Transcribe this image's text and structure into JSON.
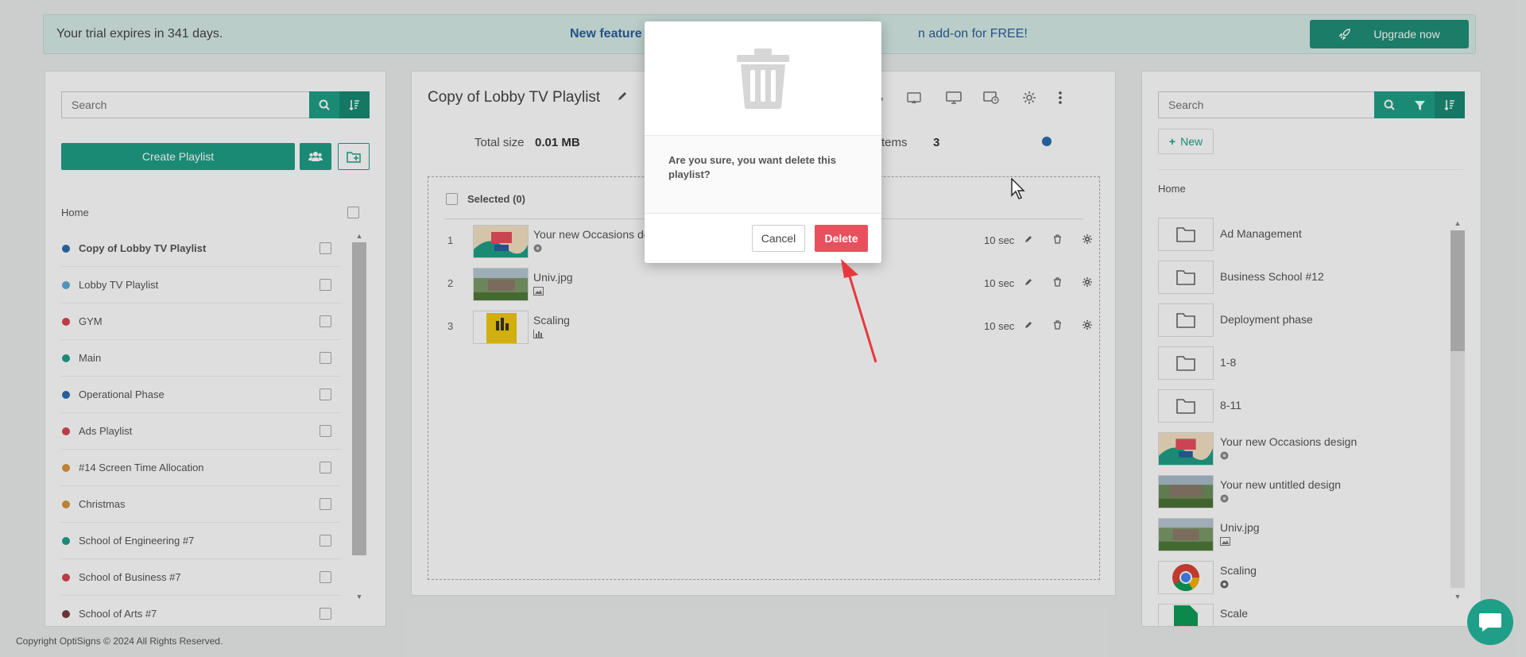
{
  "banner": {
    "trial_text": "Your trial expires in 341 days.",
    "feature_text": "New feature r",
    "addon_text": "n add-on for FREE!",
    "upgrade_label": "Upgrade now"
  },
  "left": {
    "search_placeholder": "Search",
    "create_label": "Create Playlist",
    "home_label": "Home",
    "playlists": [
      {
        "name": "Copy of Lobby TV Playlist",
        "color": "#2b6cb0",
        "active": true
      },
      {
        "name": "Lobby TV Playlist",
        "color": "#5aaadb"
      },
      {
        "name": "GYM",
        "color": "#d64550"
      },
      {
        "name": "Main",
        "color": "#1f9f87"
      },
      {
        "name": "Operational Phase",
        "color": "#2b6cb0"
      },
      {
        "name": "Ads Playlist",
        "color": "#d64550"
      },
      {
        "name": "#14 Screen Time Allocation",
        "color": "#d9963a"
      },
      {
        "name": "Christmas",
        "color": "#d9963a"
      },
      {
        "name": "School of Engineering #7",
        "color": "#1f9f87"
      },
      {
        "name": "School of Business #7",
        "color": "#d64550"
      },
      {
        "name": "School of Arts #7",
        "color": "#7a3b3b"
      }
    ]
  },
  "center": {
    "title": "Copy of Lobby TV Playlist",
    "total_size_label": "Total size",
    "total_size_value": "0.01 MB",
    "items_label": "of items",
    "items_value": "3",
    "selected_label": "Selected (0)",
    "items": [
      {
        "num": "1",
        "title": "Your new Occasions de",
        "duration": "10 sec"
      },
      {
        "num": "2",
        "title": "Univ.jpg",
        "duration": "10 sec"
      },
      {
        "num": "3",
        "title": "Scaling",
        "duration": "10 sec"
      }
    ]
  },
  "right": {
    "search_placeholder": "Search",
    "new_label": "New",
    "home_label": "Home",
    "folders": [
      "Ad Management",
      "Business School #12",
      "Deployment phase",
      "1-8",
      "8-11"
    ],
    "media": [
      "Your new Occasions design",
      "Your new untitled design",
      "Univ.jpg",
      "Scaling",
      "Scale"
    ]
  },
  "footer": "Copyright OptiSigns © 2024 All Rights Reserved.",
  "modal": {
    "message": "Are you sure, you want delete this playlist?",
    "cancel_label": "Cancel",
    "delete_label": "Delete"
  },
  "colors": {
    "accent": "#1f9f87",
    "danger": "#e8505d",
    "arrow": "#e8383f"
  }
}
